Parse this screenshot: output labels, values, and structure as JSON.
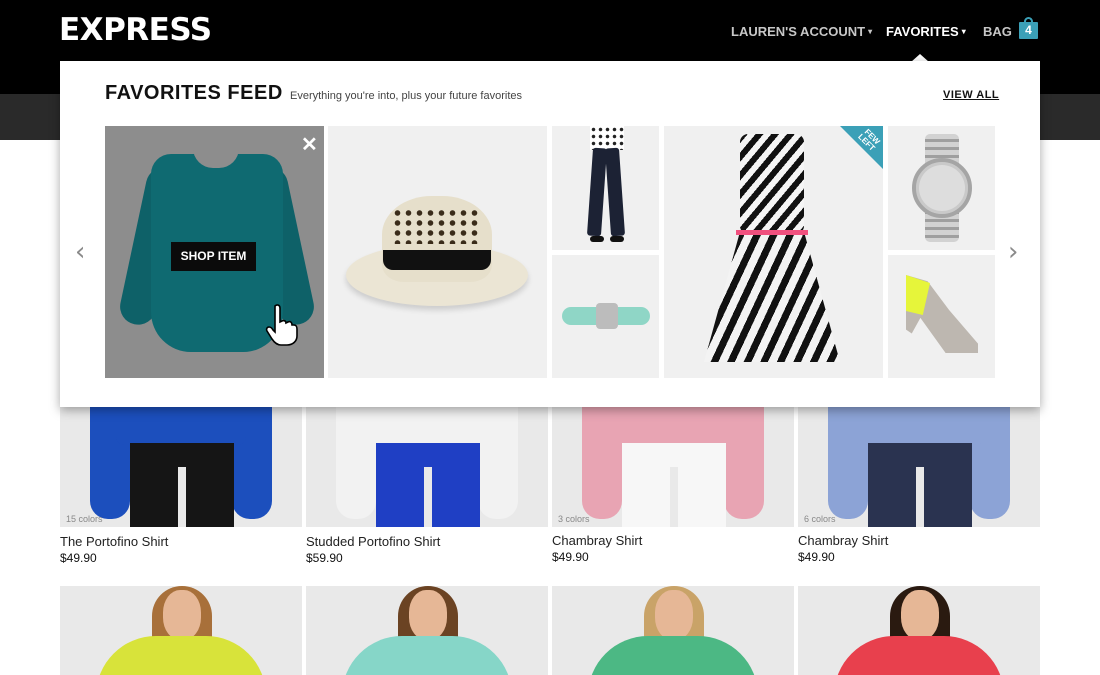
{
  "header": {
    "logo": "EXPRESS",
    "nav": {
      "account": "LAUREN'S ACCOUNT",
      "favorites": "FAVORITES",
      "bag": "BAG",
      "bag_count": "4",
      "caret": "▾"
    }
  },
  "favorites_feed": {
    "title": "FAVORITES FEED",
    "subtitle": "Everything you're into, plus your future favorites",
    "view_all": "VIEW ALL",
    "close": "✕",
    "shop_item": "SHOP ITEM",
    "badge": "FEW LEFT",
    "arrow_left": "‹",
    "arrow_right": "›",
    "items": [
      "teal blouse",
      "straw fedora hat",
      "navy skinny pants",
      "mint headband",
      "zebra print dress",
      "silver watch",
      "neon tip pump"
    ]
  },
  "products": [
    {
      "name": "The Portofino Shirt",
      "price": "$49.90",
      "colors": "15 colors",
      "shirt_color": "#1c4fbd",
      "pant_color": "#151515"
    },
    {
      "name": "Studded Portofino Shirt",
      "price": "$59.90",
      "colors": "",
      "shirt_color": "#f2f2f2",
      "pant_color": "#1f3fc4"
    },
    {
      "name": "Chambray Shirt",
      "price": "$49.90",
      "colors": "3 colors",
      "shirt_color": "#e8a4b3",
      "pant_color": "#f7f7f7"
    },
    {
      "name": "Chambray Shirt",
      "price": "$49.90",
      "colors": "6 colors",
      "shirt_color": "#8ca3d6",
      "pant_color": "#2a3350"
    }
  ],
  "second_row_colors": [
    "#d8e33a",
    "#86d6c8",
    "#4cb884",
    "#e8404d"
  ],
  "colors": {
    "accent": "#3ba0b7",
    "header_bg": "#000000",
    "subbar_bg": "#2a2a2a"
  }
}
